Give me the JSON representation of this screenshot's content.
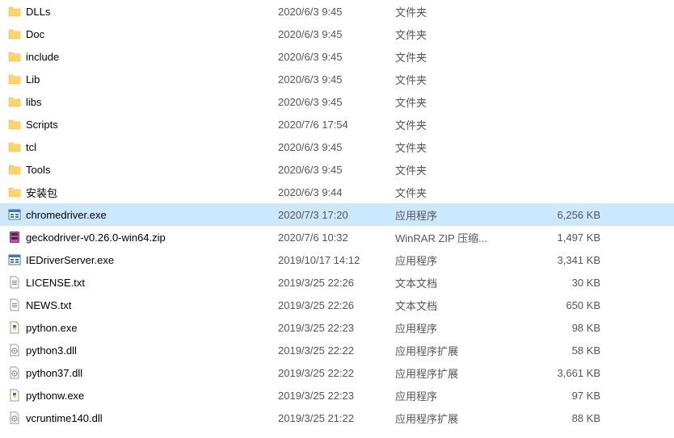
{
  "files": [
    {
      "name": "DLLs",
      "date": "2020/6/3 9:45",
      "type": "文件夹",
      "size": "",
      "icon": "folder",
      "selected": false
    },
    {
      "name": "Doc",
      "date": "2020/6/3 9:45",
      "type": "文件夹",
      "size": "",
      "icon": "folder",
      "selected": false
    },
    {
      "name": "include",
      "date": "2020/6/3 9:45",
      "type": "文件夹",
      "size": "",
      "icon": "folder",
      "selected": false
    },
    {
      "name": "Lib",
      "date": "2020/6/3 9:45",
      "type": "文件夹",
      "size": "",
      "icon": "folder",
      "selected": false
    },
    {
      "name": "libs",
      "date": "2020/6/3 9:45",
      "type": "文件夹",
      "size": "",
      "icon": "folder",
      "selected": false
    },
    {
      "name": "Scripts",
      "date": "2020/7/6 17:54",
      "type": "文件夹",
      "size": "",
      "icon": "folder",
      "selected": false
    },
    {
      "name": "tcl",
      "date": "2020/6/3 9:45",
      "type": "文件夹",
      "size": "",
      "icon": "folder",
      "selected": false
    },
    {
      "name": "Tools",
      "date": "2020/6/3 9:45",
      "type": "文件夹",
      "size": "",
      "icon": "folder",
      "selected": false
    },
    {
      "name": "安装包",
      "date": "2020/6/3 9:44",
      "type": "文件夹",
      "size": "",
      "icon": "folder",
      "selected": false
    },
    {
      "name": "chromedriver.exe",
      "date": "2020/7/3 17:20",
      "type": "应用程序",
      "size": "6,256 KB",
      "icon": "exe-win",
      "selected": true
    },
    {
      "name": "geckodriver-v0.26.0-win64.zip",
      "date": "2020/7/6 10:32",
      "type": "WinRAR ZIP 压缩...",
      "size": "1,497 KB",
      "icon": "zip",
      "selected": false
    },
    {
      "name": "IEDriverServer.exe",
      "date": "2019/10/17 14:12",
      "type": "应用程序",
      "size": "3,341 KB",
      "icon": "exe-win",
      "selected": false
    },
    {
      "name": "LICENSE.txt",
      "date": "2019/3/25 22:26",
      "type": "文本文档",
      "size": "30 KB",
      "icon": "txt",
      "selected": false
    },
    {
      "name": "NEWS.txt",
      "date": "2019/3/25 22:26",
      "type": "文本文档",
      "size": "650 KB",
      "icon": "txt",
      "selected": false
    },
    {
      "name": "python.exe",
      "date": "2019/3/25 22:23",
      "type": "应用程序",
      "size": "98 KB",
      "icon": "python",
      "selected": false
    },
    {
      "name": "python3.dll",
      "date": "2019/3/25 22:22",
      "type": "应用程序扩展",
      "size": "58 KB",
      "icon": "dll",
      "selected": false
    },
    {
      "name": "python37.dll",
      "date": "2019/3/25 22:22",
      "type": "应用程序扩展",
      "size": "3,661 KB",
      "icon": "dll",
      "selected": false
    },
    {
      "name": "pythonw.exe",
      "date": "2019/3/25 22:23",
      "type": "应用程序",
      "size": "97 KB",
      "icon": "python",
      "selected": false
    },
    {
      "name": "vcruntime140.dll",
      "date": "2019/3/25 21:22",
      "type": "应用程序扩展",
      "size": "88 KB",
      "icon": "dll",
      "selected": false
    }
  ],
  "icons": {
    "folder": "folder-icon",
    "exe-win": "app-window-icon",
    "zip": "archive-icon",
    "txt": "text-file-icon",
    "python": "python-file-icon",
    "dll": "dll-file-icon"
  }
}
